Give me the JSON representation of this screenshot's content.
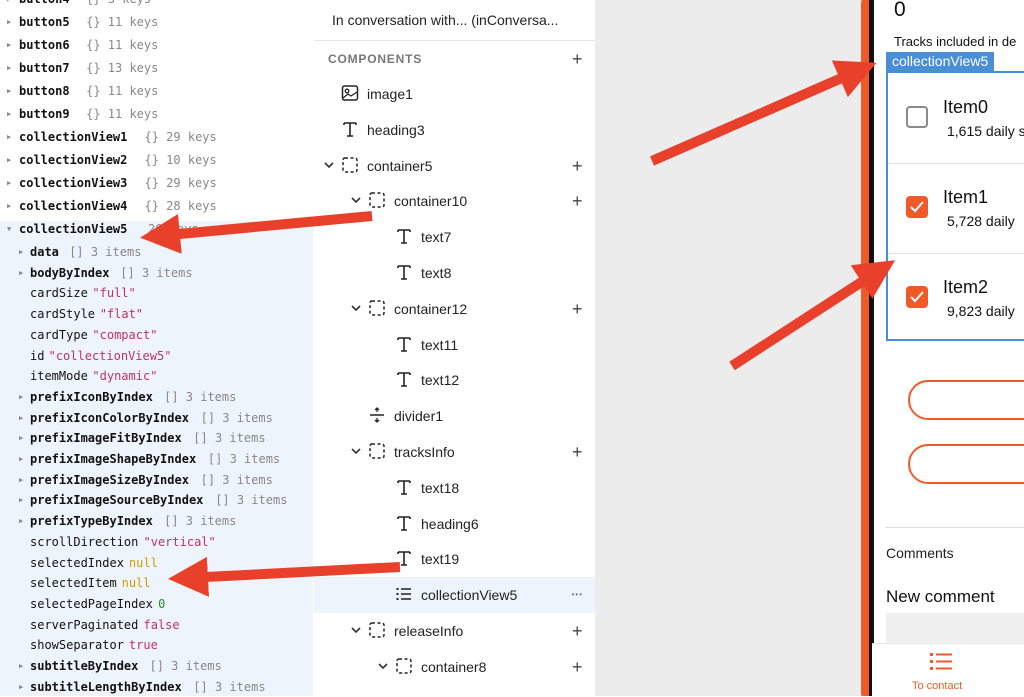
{
  "state_panel": {
    "rows": [
      {
        "key": "button4",
        "meta": "{}  3 keys",
        "tri": true,
        "bold": true
      },
      {
        "key": "button5",
        "meta": "{}  11 keys",
        "tri": true,
        "bold": true
      },
      {
        "key": "button6",
        "meta": "{}  11 keys",
        "tri": true,
        "bold": true
      },
      {
        "key": "button7",
        "meta": "{}  13 keys",
        "tri": true,
        "bold": true
      },
      {
        "key": "button8",
        "meta": "{}  11 keys",
        "tri": true,
        "bold": true
      },
      {
        "key": "button9",
        "meta": "{}  11 keys",
        "tri": true,
        "bold": true
      },
      {
        "key": "collectionView1",
        "meta": "{}  29 keys",
        "tri": true,
        "bold": true
      },
      {
        "key": "collectionView2",
        "meta": "{}  10 keys",
        "tri": true,
        "bold": true
      },
      {
        "key": "collectionView3",
        "meta": "{}  29 keys",
        "tri": true,
        "bold": true
      },
      {
        "key": "collectionView4",
        "meta": "{}  28 keys",
        "tri": true,
        "bold": true
      },
      {
        "key": "collectionView5",
        "meta": "26 keys",
        "tri": true,
        "bold": true,
        "open": true
      }
    ],
    "child_rows": [
      {
        "key": "data",
        "meta": "[]  3 items",
        "tri": true,
        "bold": true
      },
      {
        "key": "bodyByIndex",
        "meta": "[]  3 items",
        "tri": true,
        "bold": true
      },
      {
        "key": "cardSize",
        "val": "\"full\"",
        "type": "str"
      },
      {
        "key": "cardStyle",
        "val": "\"flat\"",
        "type": "str"
      },
      {
        "key": "cardType",
        "val": "\"compact\"",
        "type": "str"
      },
      {
        "key": "id",
        "val": "\"collectionView5\"",
        "type": "str"
      },
      {
        "key": "itemMode",
        "val": "\"dynamic\"",
        "type": "str"
      },
      {
        "key": "prefixIconByIndex",
        "meta": "[]  3 items",
        "tri": true,
        "bold": true
      },
      {
        "key": "prefixIconColorByIndex",
        "meta": "[]  3 items",
        "tri": true,
        "bold": true
      },
      {
        "key": "prefixImageFitByIndex",
        "meta": "[]  3 items",
        "tri": true,
        "bold": true
      },
      {
        "key": "prefixImageShapeByIndex",
        "meta": "[]  3 items",
        "tri": true,
        "bold": true
      },
      {
        "key": "prefixImageSizeByIndex",
        "meta": "[]  3 items",
        "tri": true,
        "bold": true
      },
      {
        "key": "prefixImageSourceByIndex",
        "meta": "[]  3 items",
        "tri": true,
        "bold": true
      },
      {
        "key": "prefixTypeByIndex",
        "meta": "[]  3 items",
        "tri": true,
        "bold": true
      },
      {
        "key": "scrollDirection",
        "val": "\"vertical\"",
        "type": "str"
      },
      {
        "key": "selectedIndex",
        "val": "null",
        "type": "nul"
      },
      {
        "key": "selectedItem",
        "val": "null",
        "type": "nul"
      },
      {
        "key": "selectedPageIndex",
        "val": "0",
        "type": "num"
      },
      {
        "key": "serverPaginated",
        "val": "false",
        "type": "bool"
      },
      {
        "key": "showSeparator",
        "val": "true",
        "type": "bool"
      },
      {
        "key": "subtitleByIndex",
        "meta": "[]  3 items",
        "tri": true,
        "bold": true
      },
      {
        "key": "subtitleLengthByIndex",
        "meta": "[]  3 items",
        "tri": true,
        "bold": true
      }
    ]
  },
  "tree_panel": {
    "title": "In conversation with... (inConversa...",
    "components_label": "COMPONENTS",
    "items": [
      {
        "label": "image1",
        "icon": "image",
        "level": 0
      },
      {
        "label": "heading3",
        "icon": "text",
        "level": 0
      },
      {
        "label": "container5",
        "icon": "container",
        "level": 0,
        "chev": true,
        "plus": true
      },
      {
        "label": "container10",
        "icon": "container",
        "level": 1,
        "chev": true,
        "plus": true
      },
      {
        "label": "text7",
        "icon": "text",
        "level": 2
      },
      {
        "label": "text8",
        "icon": "text",
        "level": 2
      },
      {
        "label": "container12",
        "icon": "container",
        "level": 1,
        "chev": true,
        "plus": true
      },
      {
        "label": "text11",
        "icon": "text",
        "level": 2
      },
      {
        "label": "text12",
        "icon": "text",
        "level": 2
      },
      {
        "label": "divider1",
        "icon": "divider",
        "level": 1
      },
      {
        "label": "tracksInfo",
        "icon": "container",
        "level": 1,
        "chev": true,
        "plus": true
      },
      {
        "label": "text18",
        "icon": "text",
        "level": 2
      },
      {
        "label": "heading6",
        "icon": "text",
        "level": 2
      },
      {
        "label": "text19",
        "icon": "text",
        "level": 2
      },
      {
        "label": "collectionView5",
        "icon": "list",
        "level": 2,
        "highlight": true,
        "dots": true
      },
      {
        "label": "releaseInfo",
        "icon": "container",
        "level": 1,
        "chev": true,
        "plus": true
      },
      {
        "label": "container8",
        "icon": "container",
        "level": 2,
        "chev": true,
        "plus": true
      }
    ]
  },
  "canvas": {
    "screen_number": "0",
    "partial_text": "Tracks included in de",
    "cv_label": "collectionView5",
    "items": [
      {
        "title": "Item0",
        "subtitle": "1,615 daily s",
        "checked": false
      },
      {
        "title": "Item1",
        "subtitle": "5,728 daily",
        "checked": true
      },
      {
        "title": "Item2",
        "subtitle": "9,823 daily",
        "checked": true
      }
    ],
    "comments_label": "Comments",
    "new_comment_label": "New comment",
    "nav_label": "To contact",
    "accent": "#f05a28",
    "selection_blue": "#4a8fd6",
    "arrow_red": "#e8402a"
  }
}
